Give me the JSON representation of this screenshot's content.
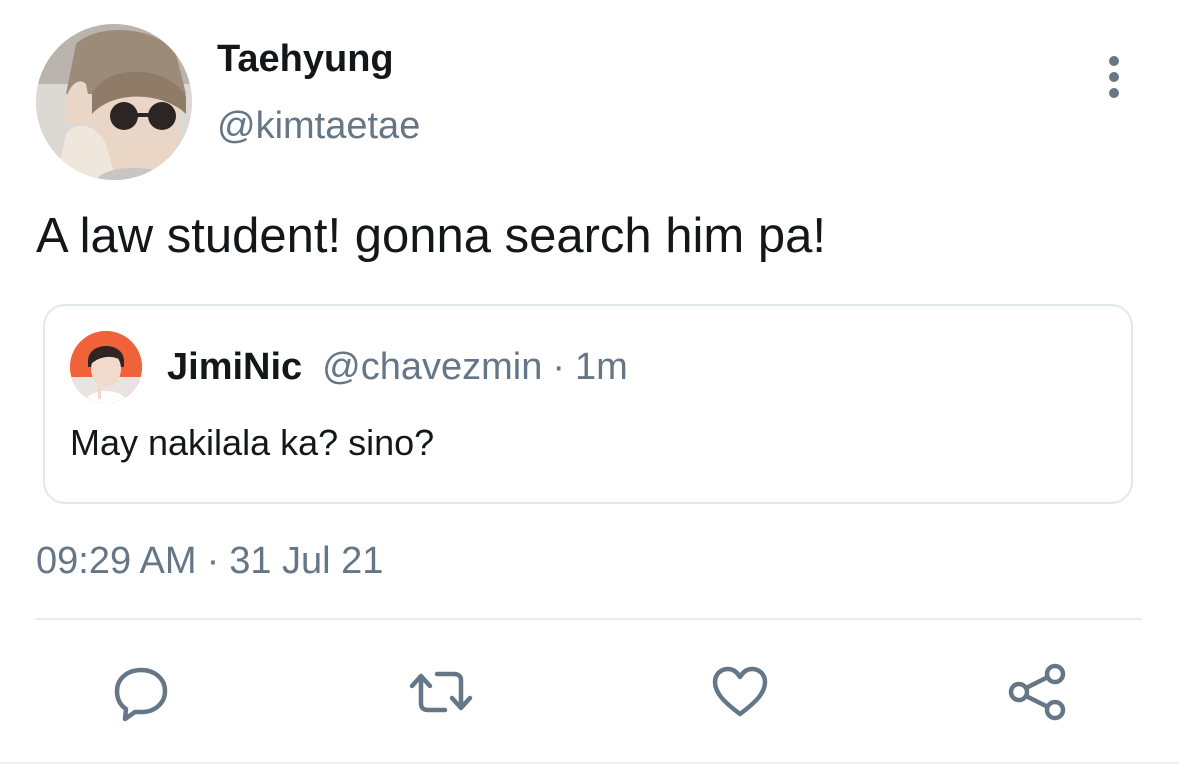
{
  "tweet": {
    "author": {
      "display_name": "Taehyung",
      "handle": "@kimtaetae",
      "avatar_icon": "profile-photo"
    },
    "text": "A law student! gonna search him pa!",
    "timestamp": {
      "time": "09:29 AM",
      "separator": "·",
      "date": "31 Jul 21"
    }
  },
  "quoted_tweet": {
    "display_name": "JimiNic",
    "handle": "@chavezmin",
    "separator": "·",
    "age": "1m",
    "text": "May nakilala ka? sino?",
    "avatar_icon": "profile-photo"
  },
  "actions": [
    {
      "icon": "reply-icon"
    },
    {
      "icon": "retweet-icon"
    },
    {
      "icon": "like-icon"
    },
    {
      "icon": "share-icon"
    }
  ],
  "colors": {
    "primary_text": "#14171a",
    "secondary_text": "#657786",
    "border": "#e1e8ed",
    "icon": "#657786"
  }
}
